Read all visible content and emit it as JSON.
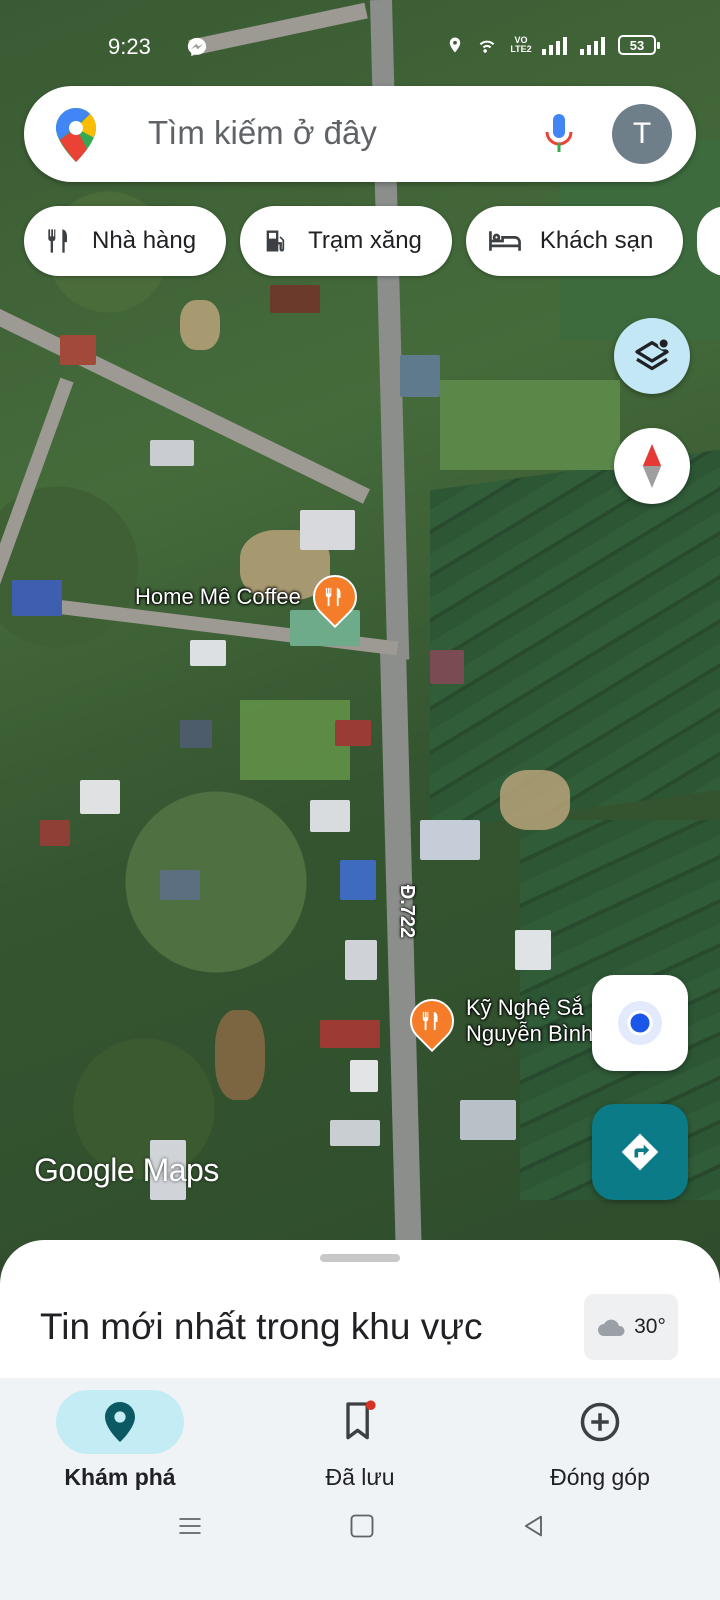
{
  "status_bar": {
    "time": "9:23",
    "network_label": "VO LTE2",
    "battery": "53"
  },
  "search": {
    "placeholder": "Tìm kiếm ở đây",
    "avatar_initial": "T"
  },
  "chips": [
    {
      "label": "Nhà hàng",
      "icon": "restaurant-icon"
    },
    {
      "label": "Trạm xăng",
      "icon": "gas-station-icon"
    },
    {
      "label": "Khách sạn",
      "icon": "hotel-icon"
    }
  ],
  "map": {
    "type": "satellite",
    "road_label": "Đ.722",
    "watermark": "Google Maps",
    "pois": [
      {
        "name": "Home Mê Coffee",
        "icon": "restaurant-icon",
        "color": "#f57c28"
      },
      {
        "name_line1": "Kỹ Nghệ Sắ",
        "name_line2": "Nguyễn Bình",
        "icon": "restaurant-icon",
        "color": "#f57c28"
      }
    ]
  },
  "sheet": {
    "title": "Tin mới nhất trong khu vực",
    "weather": "30°"
  },
  "bottom_nav": {
    "tabs": [
      {
        "label": "Khám phá",
        "icon": "explore-pin-icon",
        "active": true
      },
      {
        "label": "Đã lưu",
        "icon": "bookmark-icon",
        "active": false
      },
      {
        "label": "Đóng góp",
        "icon": "add-circle-icon",
        "active": false
      }
    ]
  },
  "colors": {
    "accent_teal": "#0b7b87",
    "layers_bg": "#c3e7f5",
    "active_tab_bg": "#c4ecf5",
    "poi_orange": "#f57c28",
    "locate_dot": "#1a56e8"
  }
}
